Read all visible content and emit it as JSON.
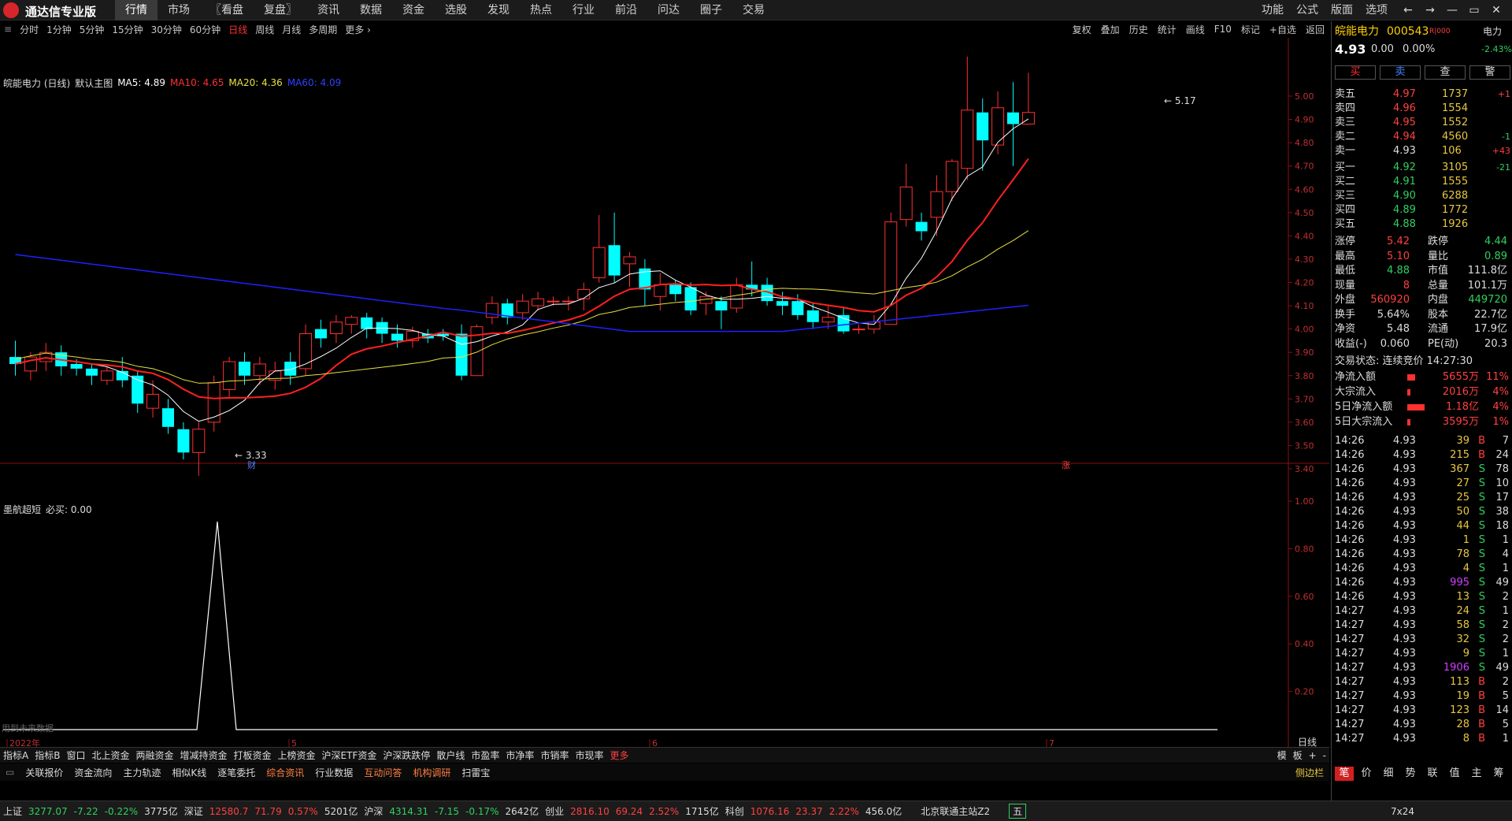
{
  "app": {
    "title": "通达信专业版",
    "menu": [
      "行情",
      "市场",
      "〖看盘",
      "复盘〗",
      "资讯",
      "数据",
      "资金",
      "选股",
      "发现",
      "热点",
      "行业",
      "前沿",
      "问达",
      "圈子",
      "交易"
    ],
    "active_menu": "行情",
    "right_menu": [
      "功能",
      "公式",
      "版面",
      "选项"
    ],
    "window_controls": [
      "←",
      "→",
      "—",
      "▭",
      "✕"
    ]
  },
  "periods": [
    "分时",
    "1分钟",
    "5分钟",
    "15分钟",
    "30分钟",
    "60分钟",
    "日线",
    "周线",
    "月线",
    "多周期",
    "更多 ›"
  ],
  "active_period": "日线",
  "toolbar": [
    "复权",
    "叠加",
    "历史",
    "统计",
    "画线",
    "F10",
    "标记",
    "+自选",
    "返回"
  ],
  "info": {
    "title": "皖能电力 (日线)",
    "main_chart": "默认主图",
    "ma5": "MA5: 4.89",
    "ma10": "MA10: 4.65",
    "ma20": "MA20: 4.36",
    "ma60": "MA60: 4.09"
  },
  "indicator": {
    "name": "墨航超短",
    "value": "必买: 0.00",
    "future": "用到未来数据"
  },
  "markers": {
    "high": "5.17",
    "low": "3.33",
    "cai": "财",
    "zhang": "涨"
  },
  "chart_data": {
    "type": "candlestick",
    "y_ticks": [
      "5.00",
      "4.90",
      "4.80",
      "4.70",
      "4.60",
      "4.50",
      "4.40",
      "4.30",
      "4.20",
      "4.10",
      "4.00",
      "3.90",
      "3.80",
      "3.70",
      "3.60",
      "3.50",
      "3.40"
    ],
    "ylim": [
      3.33,
      5.2
    ],
    "sub_ticks": [
      "1.00",
      "0.80",
      "0.60",
      "0.40",
      "0.20"
    ],
    "x_labels": [
      "2022年",
      "5",
      "6",
      "7"
    ],
    "period_label": "日线"
  },
  "right": {
    "name": "皖能电力",
    "code": "000543",
    "rkind": "R|000",
    "tag": "电力",
    "pct_tag": "-2.43%",
    "price": "4.93",
    "chg": "0.00",
    "pct": "0.00%",
    "btn_buy": "买",
    "btn_sell": "卖",
    "btn_check": "查",
    "btn_alert": "警",
    "asks": [
      {
        "l": "卖五",
        "p": "4.97",
        "v": "1737",
        "d": "+1"
      },
      {
        "l": "卖四",
        "p": "4.96",
        "v": "1554",
        "d": ""
      },
      {
        "l": "卖三",
        "p": "4.95",
        "v": "1552",
        "d": ""
      },
      {
        "l": "卖二",
        "p": "4.94",
        "v": "4560",
        "d": "-1"
      },
      {
        "l": "卖一",
        "p": "4.93",
        "v": "106",
        "d": "+43"
      }
    ],
    "bids": [
      {
        "l": "买一",
        "p": "4.92",
        "v": "3105",
        "d": "-21"
      },
      {
        "l": "买二",
        "p": "4.91",
        "v": "1555",
        "d": ""
      },
      {
        "l": "买三",
        "p": "4.90",
        "v": "6288",
        "d": ""
      },
      {
        "l": "买四",
        "p": "4.89",
        "v": "1772",
        "d": ""
      },
      {
        "l": "买五",
        "p": "4.88",
        "v": "1926",
        "d": ""
      }
    ],
    "stats": [
      [
        "涨停",
        "5.42",
        "跌停",
        "4.44"
      ],
      [
        "最高",
        "5.10",
        "量比",
        "0.89"
      ],
      [
        "最低",
        "4.88",
        "市值",
        "111.8亿"
      ],
      [
        "现量",
        "8",
        "总量",
        "101.1万"
      ],
      [
        "外盘",
        "560920",
        "内盘",
        "449720"
      ],
      [
        "换手",
        "5.64%",
        "股本",
        "22.7亿"
      ],
      [
        "净资",
        "5.48",
        "流通",
        "17.9亿"
      ],
      [
        "收益(-)",
        "0.060",
        "PE(动)",
        "20.3"
      ]
    ],
    "trade_state": "交易状态: 连续竞价 14:27:30",
    "flows": [
      [
        "净流入额",
        "5655万",
        "11%"
      ],
      [
        "大宗流入",
        "2016万",
        "4%"
      ],
      [
        "5日净流入额",
        "1.18亿",
        "4%"
      ],
      [
        "5日大宗流入",
        "3595万",
        "1%"
      ]
    ],
    "ticks": [
      [
        "14:26",
        "4.93",
        "39",
        "B",
        "7"
      ],
      [
        "14:26",
        "4.93",
        "215",
        "B",
        "24"
      ],
      [
        "14:26",
        "4.93",
        "367",
        "S",
        "78"
      ],
      [
        "14:26",
        "4.93",
        "27",
        "S",
        "10"
      ],
      [
        "14:26",
        "4.93",
        "25",
        "S",
        "17"
      ],
      [
        "14:26",
        "4.93",
        "50",
        "S",
        "38"
      ],
      [
        "14:26",
        "4.93",
        "44",
        "S",
        "18"
      ],
      [
        "14:26",
        "4.93",
        "1",
        "S",
        "1"
      ],
      [
        "14:26",
        "4.93",
        "78",
        "S",
        "4"
      ],
      [
        "14:26",
        "4.93",
        "4",
        "S",
        "1"
      ],
      [
        "14:26",
        "4.93",
        "995",
        "S",
        "49"
      ],
      [
        "14:26",
        "4.93",
        "13",
        "S",
        "2"
      ],
      [
        "14:27",
        "4.93",
        "24",
        "S",
        "1"
      ],
      [
        "14:27",
        "4.93",
        "58",
        "S",
        "2"
      ],
      [
        "14:27",
        "4.93",
        "32",
        "S",
        "2"
      ],
      [
        "14:27",
        "4.93",
        "9",
        "S",
        "1"
      ],
      [
        "14:27",
        "4.93",
        "1906",
        "S",
        "49"
      ],
      [
        "14:27",
        "4.93",
        "113",
        "B",
        "2"
      ],
      [
        "14:27",
        "4.93",
        "19",
        "B",
        "5"
      ],
      [
        "14:27",
        "4.93",
        "123",
        "B",
        "14"
      ],
      [
        "14:27",
        "4.93",
        "28",
        "B",
        "5"
      ],
      [
        "14:27",
        "4.93",
        "8",
        "B",
        "1"
      ]
    ],
    "tabs": [
      "笔",
      "价",
      "细",
      "势",
      "联",
      "值",
      "主",
      "筹"
    ]
  },
  "bottom1": [
    "指标A",
    "指标B",
    "窗口",
    "北上资金",
    "两融资金",
    "增减持资金",
    "打板资金",
    "上榜资金",
    "沪深ETF资金",
    "沪深跌跌停",
    "散户线",
    "市盈率",
    "市净率",
    "市销率",
    "市现率",
    "更多"
  ],
  "bottom1_right": [
    "模",
    "板",
    "+",
    "-"
  ],
  "bottom2": [
    "关联报价",
    "资金流向",
    "主力轨迹",
    "相似K线",
    "逐笔委托",
    "综合资讯",
    "行业数据",
    "互动问答",
    "机构调研",
    "扫雷宝"
  ],
  "bottom2_right": "侧边栏",
  "status": [
    [
      "上证",
      "3277.07",
      "-7.22",
      "-0.22%",
      "3775亿"
    ],
    [
      "深证",
      "12580.7",
      "71.79",
      "0.57%",
      "5201亿"
    ],
    [
      "沪深",
      "4314.31",
      "-7.15",
      "-0.17%",
      "2642亿"
    ],
    [
      "创业",
      "2816.10",
      "69.24",
      "2.52%",
      "1715亿"
    ],
    [
      "科创",
      "1076.16",
      "23.37",
      "2.22%",
      "456.0亿"
    ]
  ],
  "status_right": {
    "server": "北京联通主站Z2",
    "ime": "五",
    "clock": "7x24"
  }
}
